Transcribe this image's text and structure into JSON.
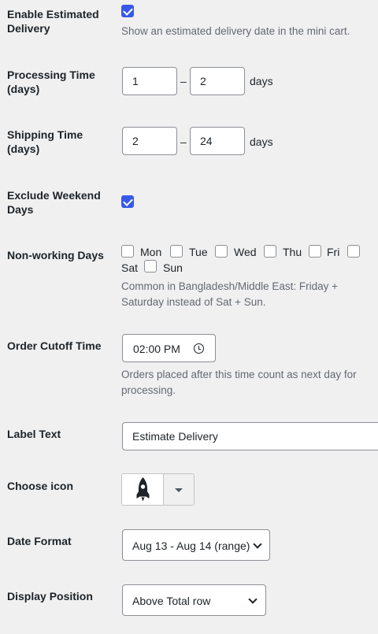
{
  "estimated_delivery": {
    "label": "Enable Estimated Delivery",
    "checked": true,
    "description": "Show an estimated delivery date in the mini cart."
  },
  "processing_time": {
    "label": "Processing Time (days)",
    "min": "1",
    "separator": "–",
    "max": "2",
    "unit": "days"
  },
  "shipping_time": {
    "label": "Shipping Time (days)",
    "min": "2",
    "separator": "–",
    "max": "24",
    "unit": "days"
  },
  "exclude_weekend": {
    "label": "Exclude Weekend Days",
    "checked": true
  },
  "non_working_days": {
    "label": "Non-working Days",
    "days": [
      "Mon",
      "Tue",
      "Wed",
      "Thu",
      "Fri",
      "Sat",
      "Sun"
    ],
    "description": "Common in Bangladesh/Middle East: Friday + Saturday instead of Sat + Sun."
  },
  "order_cutoff": {
    "label": "Order Cutoff Time",
    "value": "02:00 PM",
    "icon": "clock-icon",
    "description": "Orders placed after this time count as next day for processing."
  },
  "label_text": {
    "label": "Label Text",
    "value": "Estimate Delivery"
  },
  "choose_icon": {
    "label": "Choose icon",
    "selected_icon": "rocket-icon"
  },
  "date_format": {
    "label": "Date Format",
    "selected": "Aug 13 - Aug 14 (range)"
  },
  "display_position": {
    "label": "Display Position",
    "selected": "Above Total row"
  },
  "colors": {
    "checkbox_checked": "#3858e9",
    "text": "#1d2327",
    "description": "#646970",
    "border": "#8c8f94"
  }
}
